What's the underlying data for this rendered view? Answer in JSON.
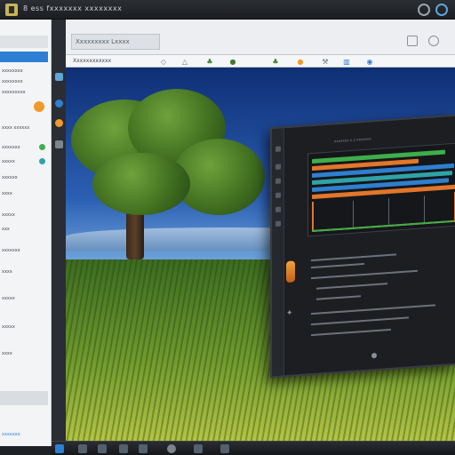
{
  "window": {
    "title": "8  ess  fxxxxxxx  xxxxxxxx"
  },
  "toolbar": {
    "brand_label": "Xxxxxxxxx Lxxxx",
    "subbar_label": "Xxxxxxxxxxxx"
  },
  "sidebar": {
    "items": [
      {
        "label": "xxxxxxxx"
      },
      {
        "label": "xxxxxxxx"
      },
      {
        "label": "xxxxxxxxx"
      },
      {
        "label": "xxxx xxxxxx"
      },
      {
        "label": "xxxxxxx"
      },
      {
        "label": "xxxxx"
      },
      {
        "label": "xxxxxx"
      },
      {
        "label": "xxxx"
      },
      {
        "label": "xxxxx"
      },
      {
        "label": "xxx"
      },
      {
        "label": "xxxxxxx"
      },
      {
        "label": "xxxx"
      },
      {
        "label": "xxxxx"
      },
      {
        "label": "xxxxx"
      },
      {
        "label": "xxxx"
      }
    ],
    "footer_link": "xxxxxxx"
  },
  "app_window": {
    "heading": "xxxxxxx  x x xxxxxxx"
  },
  "colors": {
    "accent": "#2e7fd3",
    "badge": "#f09a2b",
    "track_orange": "#e2762b",
    "track_green": "#3fae4a",
    "track_blue": "#2f7fcf",
    "track_teal": "#2fa3a8"
  },
  "icons": {
    "system": [
      "app-logo-icon",
      "window-control-icon",
      "window-control-icon"
    ],
    "toolbar": [
      "pin-icon",
      "arrow-icon",
      "leaf-icon",
      "leaf-icon",
      "flag-icon",
      "orange-circle-icon",
      "tool-icon",
      "book-icon",
      "globe-icon"
    ]
  }
}
